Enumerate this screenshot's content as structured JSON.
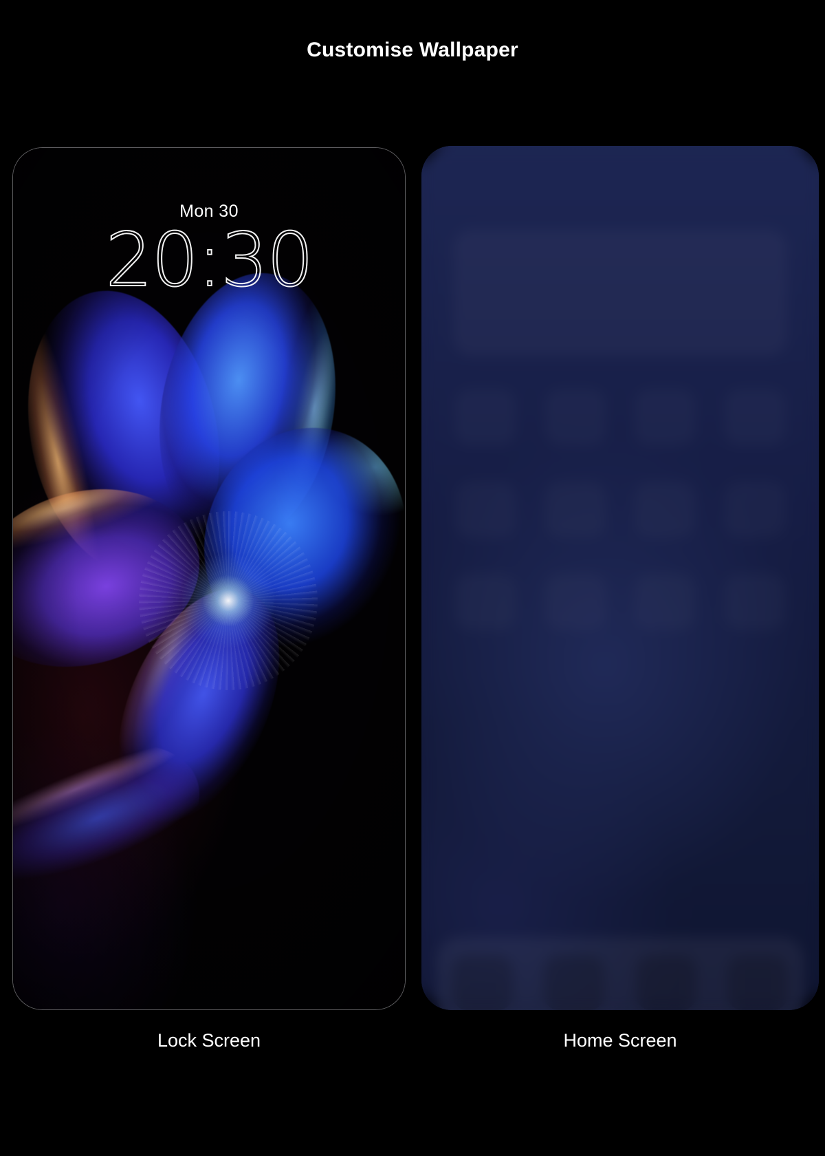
{
  "header": {
    "title": "Customise Wallpaper"
  },
  "previews": {
    "lock": {
      "caption": "Lock Screen",
      "date": "Mon 30",
      "time": "20:30",
      "wallpaper_name": "neon-flower-wallpaper",
      "colors": {
        "background": "#020103",
        "petal_blue": "#3c5aff",
        "petal_cyan": "#82e6ff",
        "petal_purple": "#8246f0",
        "petal_orange": "#ffc882",
        "frame_border": "#aaaaaf"
      }
    },
    "home": {
      "caption": "Home Screen",
      "widget_count": 1,
      "icon_rows": 3,
      "icon_columns": 4,
      "dock_icon_count": 4,
      "colors": {
        "background": "#161d45",
        "background_top": "#263060",
        "background_bottom": "#0f1531",
        "icon_tile": "rgba(255,255,255,0.028)",
        "dock_panel": "rgba(255,255,255,0.055)"
      }
    }
  },
  "page": {
    "background_color": "#000000",
    "text_color": "#ffffff"
  }
}
